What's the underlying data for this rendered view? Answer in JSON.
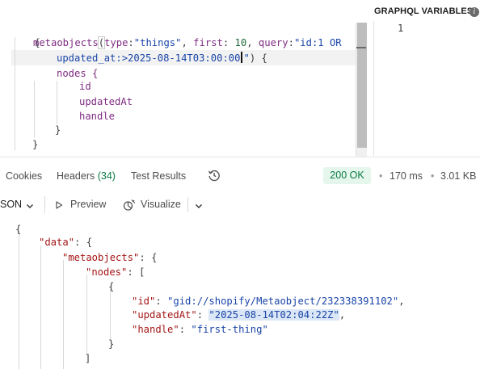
{
  "query_editor": {
    "lines": [
      {
        "text": "{"
      },
      {
        "field": "metaobjects",
        "open_paren": "(",
        "arg1_key": "type",
        "arg1_val": "\"things\"",
        "sep1": ", ",
        "arg2_key": "first",
        "arg2_val": "10",
        "sep2": ", ",
        "arg3_key": "query",
        "arg3_val_start": "\"id:1 OR"
      },
      {
        "continued": "updated_at:>2025-08-14T03:00:00",
        "quote_end": "\"",
        "close": ") {"
      },
      {
        "text": "nodes {"
      },
      {
        "text": "id"
      },
      {
        "text": "updatedAt"
      },
      {
        "text": "handle"
      },
      {
        "text": "}"
      },
      {
        "text": "}"
      }
    ]
  },
  "variables": {
    "title": "GRAPHQL VARIABLES",
    "info_icon": "info-icon",
    "line_number": "1"
  },
  "tabs": [
    {
      "label": "Cookies"
    },
    {
      "label": "Headers",
      "count": "(34)"
    },
    {
      "label": "Test Results"
    }
  ],
  "response_meta": {
    "status": "200 OK",
    "time": "170 ms",
    "size": "3.01 KB",
    "status_color": "#0b7a43"
  },
  "response_toolbar": {
    "format": "SON",
    "preview_label": "Preview",
    "visualize_label": "Visualize"
  },
  "response_json": {
    "open_brace": "{",
    "data_key": "\"data\"",
    "metaobjects_key": "\"metaobjects\"",
    "nodes_key": "\"nodes\"",
    "id_key": "\"id\"",
    "id_value": "\"gid://shopify/Metaobject/232338391102\"",
    "updated_key": "\"updatedAt\"",
    "updated_value": "\"2025-08-14T02:04:22Z\"",
    "handle_key": "\"handle\"",
    "handle_value": "\"first-thing\""
  }
}
